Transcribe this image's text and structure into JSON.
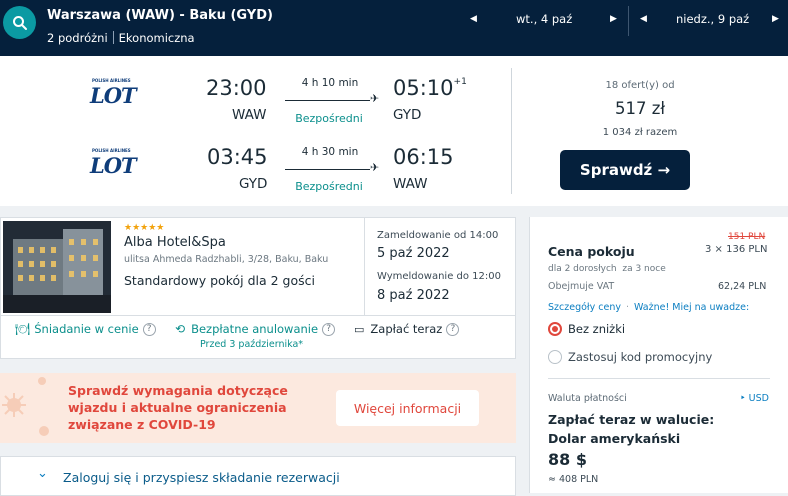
{
  "header": {
    "route": "Warszawa (WAW) - Baku (GYD)",
    "travellers": "2 podróżni",
    "cabin": "Ekonomiczna",
    "depart_date": "wt., 4 paź",
    "return_date": "niedz., 9 paź",
    "prev_arrow": "◀",
    "next_arrow": "▶"
  },
  "flights": {
    "airline": "LOT",
    "airline_tagline": "POLISH AIRLINES",
    "outbound": {
      "dep_time": "23:00",
      "dep_code": "WAW",
      "duration": "4 h 10 min",
      "stops": "Bezpośredni",
      "arr_time": "05:10",
      "day_offset": "+1",
      "arr_code": "GYD"
    },
    "inbound": {
      "dep_time": "03:45",
      "dep_code": "GYD",
      "duration": "4 h 30 min",
      "stops": "Bezpośredni",
      "arr_time": "06:15",
      "arr_code": "WAW"
    },
    "offers_count": "18 ofert(y) od",
    "price": "517 zł",
    "total": "1 034 zł razem",
    "cta": "Sprawdź →"
  },
  "hotel": {
    "stars": "★★★★★",
    "name": "Alba Hotel&Spa",
    "address": "ulitsa Ahmeda Radzhabli, 3/28, Baku, Baku",
    "room": "Standardowy pokój dla 2 gości",
    "checkin_label": "Zameldowanie od 14:00",
    "checkin_date": "5 paź 2022",
    "checkout_label": "Wymeldowanie do 12:00",
    "checkout_date": "8 paź 2022",
    "breakfast": "Śniadanie w cenie",
    "free_cancel": "Bezpłatne anulowanie",
    "free_cancel_until": "Przed 3 października*",
    "pay_now": "Zapłać teraz",
    "help": "?"
  },
  "covid": {
    "line1": "Sprawdź wymagania dotyczące",
    "line2": "wjazdu i aktualne ograniczenia",
    "line3": "związane z COVID-19",
    "button": "Więcej informacji"
  },
  "login": {
    "chevron": "⌄",
    "text": "Zaloguj się i przyspiesz składanie rezerwacji"
  },
  "pricing": {
    "old_price": "151 PLN",
    "room_price_label": "Cena pokoju",
    "room_calc": "3 × 136 PLN",
    "guests": "dla 2 dorosłych  za 3 noce",
    "vat_label": "Obejmuje VAT",
    "vat_value": "62,24 PLN",
    "details_link": "Szczegóły ceny",
    "note_link": "Ważne! Miej na uwadze:",
    "opt_no_discount": "Bez zniżki",
    "opt_promo": "Zastosuj kod promocyjny",
    "currency_label": "Waluta płatności",
    "currency_value": "‣ USD",
    "pay_title_1": "Zapłać teraz w walucie:",
    "pay_title_2": "Dolar amerykański",
    "pay_amount": "88 $",
    "pay_approx": "≈ 408 PLN"
  }
}
